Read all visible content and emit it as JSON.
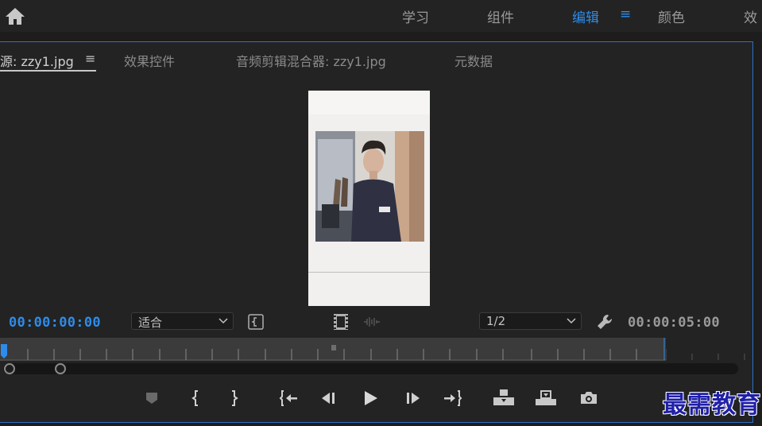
{
  "workspace_tabs": {
    "learn": "学习",
    "assemble": "组件",
    "edit": "编辑",
    "color": "颜色",
    "effects_partial": "效"
  },
  "workspace_menu_glyph": "≡",
  "panel_tabs": {
    "source": "源: zzy1.jpg",
    "source_menu": "≡",
    "effect_controls": "效果控件",
    "audio_mixer": "音频剪辑混合器: zzy1.jpg",
    "metadata": "元数据"
  },
  "controls": {
    "current_timecode": "00:00:00:00",
    "zoom_fit": "适合",
    "resolution": "1/2",
    "duration_timecode": "00:00:05:00"
  },
  "watermark": "最需教育",
  "colors": {
    "accent": "#2d8ceb",
    "panel_border": "#2d6fc4",
    "background": "#1d1d1d"
  },
  "icons": {
    "home": "home-icon",
    "insert": "insert-icon",
    "overwrite": "overwrite-icon",
    "export_frame": "camera-icon",
    "settings": "wrench-icon"
  }
}
